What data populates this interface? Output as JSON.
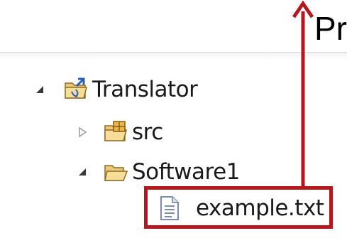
{
  "annotation": {
    "caption": "Pr",
    "accent_color": "#b5171e"
  },
  "tree": {
    "items": [
      {
        "label": "Translator",
        "icon": "java-project-icon",
        "toggle": "expanded"
      },
      {
        "label": "src",
        "icon": "package-folder-icon",
        "toggle": "collapsed"
      },
      {
        "label": "Software1",
        "icon": "folder-open-icon",
        "toggle": "expanded"
      },
      {
        "label": "example.txt",
        "icon": "text-file-icon",
        "toggle": "none"
      }
    ]
  }
}
